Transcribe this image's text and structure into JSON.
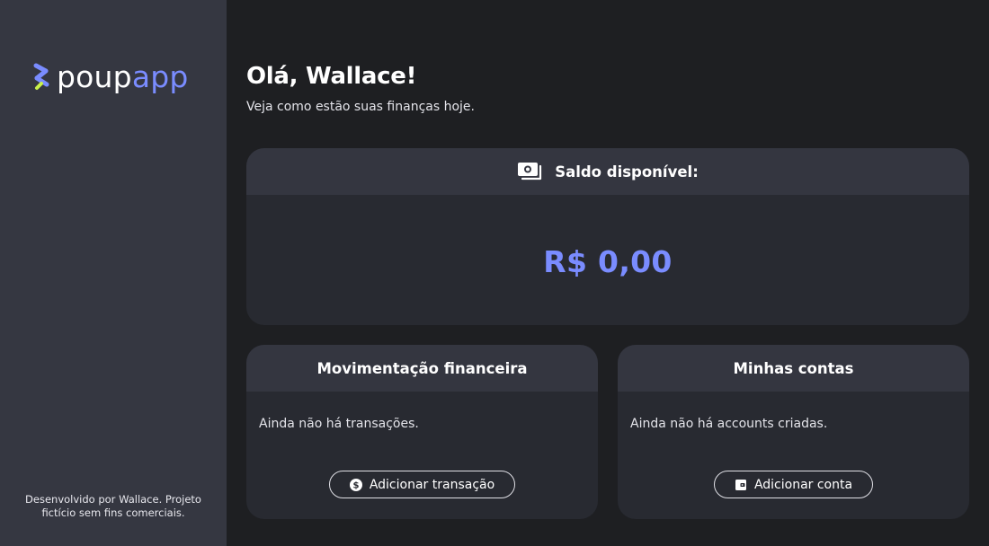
{
  "brand": {
    "name_white": "poup",
    "name_accent": "app",
    "accent_color": "#7a8cff"
  },
  "sidebar": {
    "footer": "Desenvolvido por Wallace. Projeto fictício sem fins comerciais."
  },
  "main": {
    "greeting": "Olá, Wallace!",
    "subtitle": "Veja como estão suas finanças hoje."
  },
  "balance": {
    "title": "Saldo disponível:",
    "value": "R$ 0,00",
    "icon": "cash-icon"
  },
  "transactions": {
    "title": "Movimentação financeira",
    "empty": "Ainda não há transações.",
    "button_label": "Adicionar transação",
    "button_icon": "dollar-circle-icon"
  },
  "accounts": {
    "title": "Minhas contas",
    "empty": "Ainda não há accounts criadas.",
    "button_label": "Adicionar conta",
    "button_icon": "wallet-icon"
  }
}
